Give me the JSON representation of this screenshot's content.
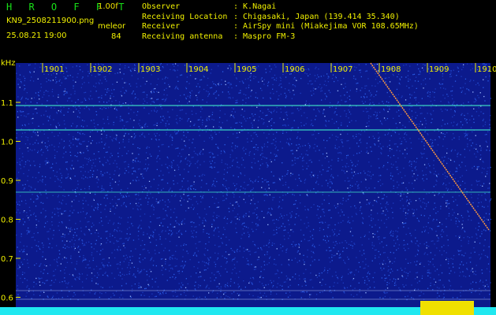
{
  "header": {
    "app_title": "H R O F F T",
    "version": "1.00f",
    "file_name": "KN9_2508211900.png",
    "datetime": "25.08.21 19:00",
    "mode": "meleor",
    "count": "84"
  },
  "info": [
    {
      "label": "Observer",
      "value": ": K.Nagai"
    },
    {
      "label": "Receiving Location",
      "value": ": Chigasaki, Japan (139.414 35.340)"
    },
    {
      "label": "Receiver",
      "value": ": AirSpy mini (Miakejima VOR 108.65MHz)"
    },
    {
      "label": "Receiving antenna",
      "value": ": Maspro FM-3"
    }
  ],
  "spectrogram": {
    "unit_label": "kHz",
    "time_ticks": [
      "1901",
      "1902",
      "1903",
      "1904",
      "1905",
      "1906",
      "1907",
      "1908",
      "1909",
      "1910"
    ],
    "freq_ticks": [
      "1.1",
      "1.0",
      "0.9",
      "0.8",
      "0.7",
      "0.6"
    ],
    "colors": {
      "background": "#0c1a8c",
      "noise": "#2a5ce6",
      "line": "#40e8c8",
      "axis": "#f0f000",
      "trace": "#ff9a40"
    }
  }
}
